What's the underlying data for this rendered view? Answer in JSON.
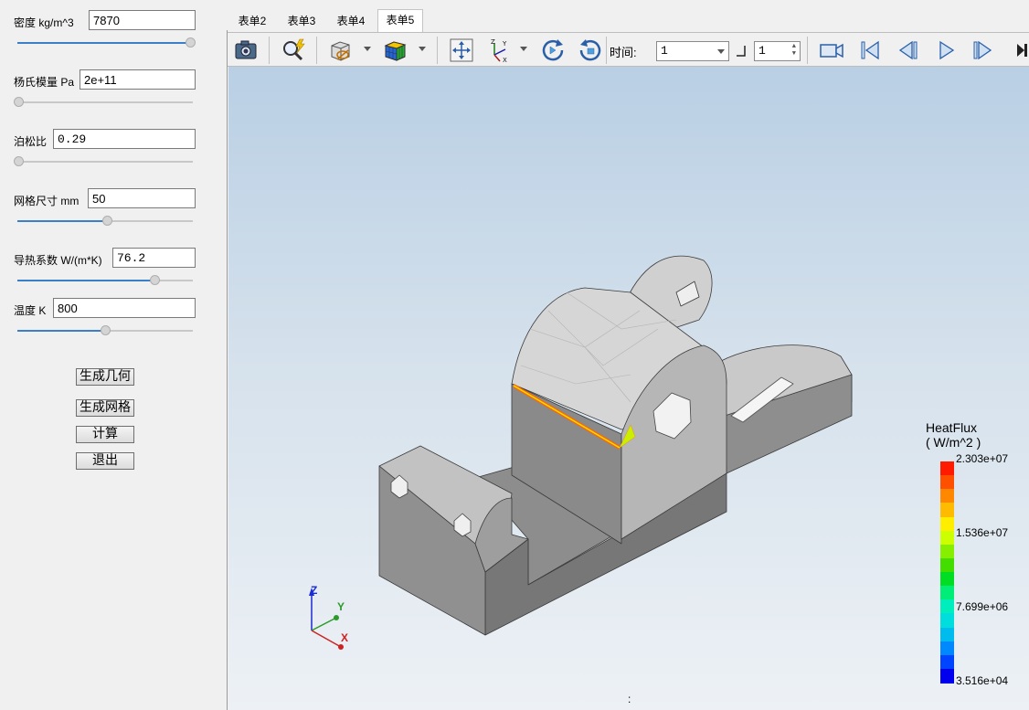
{
  "params": [
    {
      "label": "密度 kg/m^3",
      "value": "7870",
      "slider": 0.98
    },
    {
      "label": "杨氏模量 Pa",
      "value": "2e+11",
      "slider": 0.0
    },
    {
      "label": "泊松比",
      "value": "0.29",
      "slider": 0.0
    },
    {
      "label": "网格尺寸 mm",
      "value": "50",
      "slider": 0.5
    },
    {
      "label": "导热系数 W/(m*K)",
      "value": "76.2",
      "slider": 0.78
    },
    {
      "label": "温度 K",
      "value": "800",
      "slider": 0.5
    }
  ],
  "buttons": {
    "generate_geometry": "生成几何",
    "generate_mesh": "生成网格",
    "compute": "计算",
    "exit": "退出"
  },
  "tabs": [
    "表单2",
    "表单3",
    "表单4",
    "表单5"
  ],
  "active_tab": "表单5",
  "toolbar": {
    "time_label": "时间:",
    "time_value": "1",
    "frame_value": "1",
    "icons": [
      "camera-icon",
      "zoom-icon",
      "cube-visibility-icon",
      "color-cube-icon",
      "fit-view-icon",
      "axes-orientation-icon",
      "rotate-cw-icon",
      "rotate-ccw-icon",
      "record-icon",
      "first-frame-icon",
      "previous-frame-icon",
      "play-icon",
      "next-frame-icon",
      "last-frame-icon"
    ]
  },
  "colorbar": {
    "title_line1": "HeatFlux",
    "title_line2": "( W/m^2 )",
    "max": "2.303e+07",
    "mid_high": "1.536e+07",
    "mid_low": "7.699e+06",
    "min": "3.516e+04",
    "colors": [
      "#ff1a00",
      "#ff5000",
      "#ff8800",
      "#ffbb00",
      "#ffee00",
      "#ccff00",
      "#88ee00",
      "#44dd00",
      "#00dd22",
      "#00ee77",
      "#00eebb",
      "#00dddd",
      "#00bbee",
      "#0088ff",
      "#0044ff",
      "#0000ee"
    ]
  },
  "axes": {
    "x": "X",
    "y": "Y",
    "z": "Z"
  },
  "status_text": ":"
}
